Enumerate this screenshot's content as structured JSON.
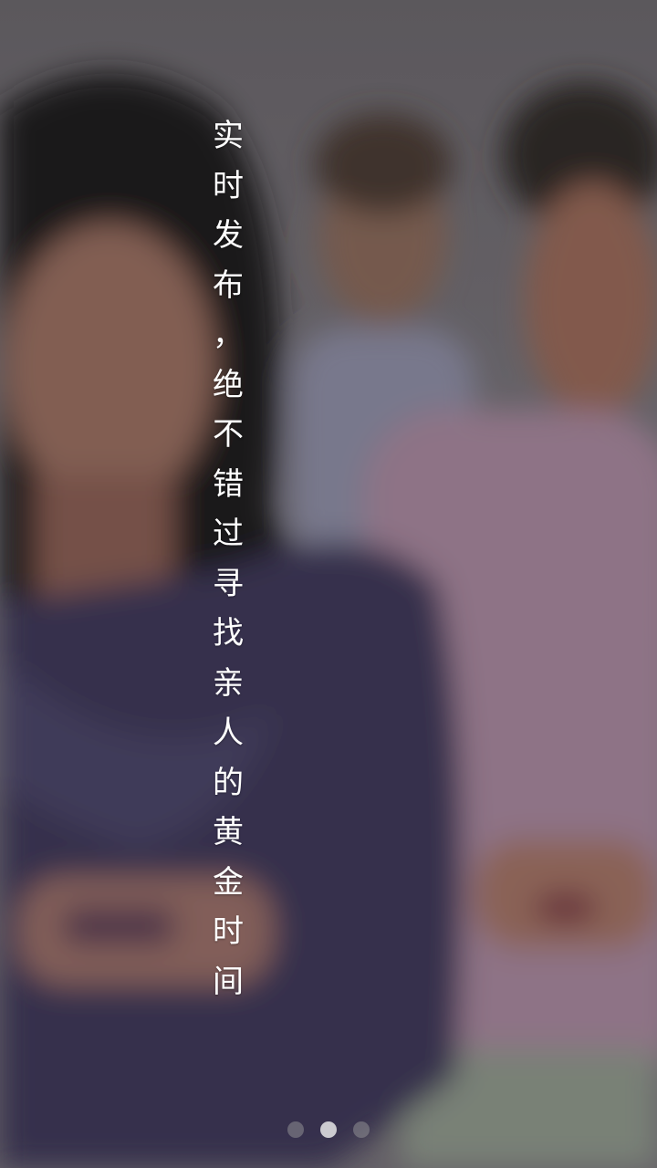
{
  "splash": {
    "tagline_chars": [
      "实",
      "时",
      "发",
      "布",
      "，",
      "绝",
      "不",
      "错",
      "过",
      "寻",
      "找",
      "亲",
      "人",
      "的",
      "黄",
      "金",
      "时",
      "间"
    ],
    "background_image": "blurred-photo-people-using-phones"
  },
  "pager": {
    "count": 3,
    "active_index": 1
  },
  "colors": {
    "text": "#ffffff",
    "dot_inactive": "#8f8f94",
    "dot_active": "#e6e6e8"
  }
}
